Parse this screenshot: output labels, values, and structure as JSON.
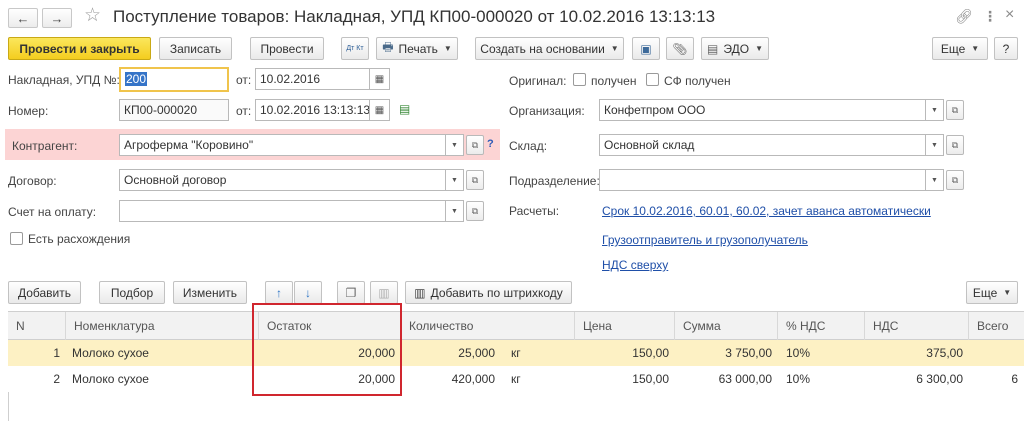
{
  "window": {
    "title": "Поступление товаров: Накладная, УПД КП00-000020 от 10.02.2016 13:13:13",
    "link_icon": "link-icon",
    "menu_icon": "more-vertical-icon",
    "help_label": "?",
    "close_label": "×"
  },
  "toolbar": {
    "post_close": "Провести и закрыть",
    "save": "Записать",
    "post": "Провести",
    "dt_kt": "Дт Кт",
    "print": "Печать",
    "create_based": "Создать на основании",
    "edo": "ЭДО",
    "more": "Еще",
    "help": "?"
  },
  "form": {
    "invoice_label": "Накладная, УПД №:",
    "invoice_value": "200",
    "from_label": "от:",
    "invoice_date": "10.02.2016",
    "number_label": "Номер:",
    "number_value": "КП00-000020",
    "number_date": "10.02.2016 13:13:13",
    "counterparty_label": "Контрагент:",
    "counterparty_value": "Агроферма \"Коровино\"",
    "contract_label": "Договор:",
    "contract_value": "Основной договор",
    "payment_label": "Счет на оплату:",
    "payment_value": "",
    "discrepancy_label": "Есть расхождения",
    "original_label": "Оригинал:",
    "received_label": "получен",
    "sf_received_label": "СФ получен",
    "org_label": "Организация:",
    "org_value": "Конфетпром ООО",
    "warehouse_label": "Склад:",
    "warehouse_value": "Основной склад",
    "department_label": "Подразделение:",
    "department_value": "",
    "settlements_label": "Расчеты:",
    "settlements_link": "Срок 10.02.2016, 60.01, 60.02, зачет аванса автоматически",
    "shipper_link": "Грузоотправитель и грузополучатель",
    "vat_link": "НДС сверху",
    "help_q": "?"
  },
  "table_toolbar": {
    "add": "Добавить",
    "pick": "Подбор",
    "change": "Изменить",
    "barcode": "Добавить по штрихкоду",
    "more": "Еще"
  },
  "table": {
    "columns": [
      "N",
      "Номенклатура",
      "Остаток",
      "Количество",
      "",
      "Цена",
      "Сумма",
      "% НДС",
      "НДС",
      "Всего"
    ],
    "rows": [
      {
        "n": "1",
        "item": "Молоко сухое",
        "stock": "20,000",
        "qty": "25,000",
        "unit": "кг",
        "price": "150,00",
        "sum": "3 750,00",
        "vat_pct": "10%",
        "vat": "375,00",
        "total": ""
      },
      {
        "n": "2",
        "item": "Молоко сухое",
        "stock": "20,000",
        "qty": "420,000",
        "unit": "кг",
        "price": "150,00",
        "sum": "63 000,00",
        "vat_pct": "10%",
        "vat": "6 300,00",
        "total": "6"
      }
    ]
  },
  "colors": {
    "primary_button": "#f4cd1f",
    "selected_row": "#fdf1c4",
    "highlight_box": "#d0262e",
    "error_field_bg": "#fcd4d4",
    "link": "#1f4fa8"
  }
}
